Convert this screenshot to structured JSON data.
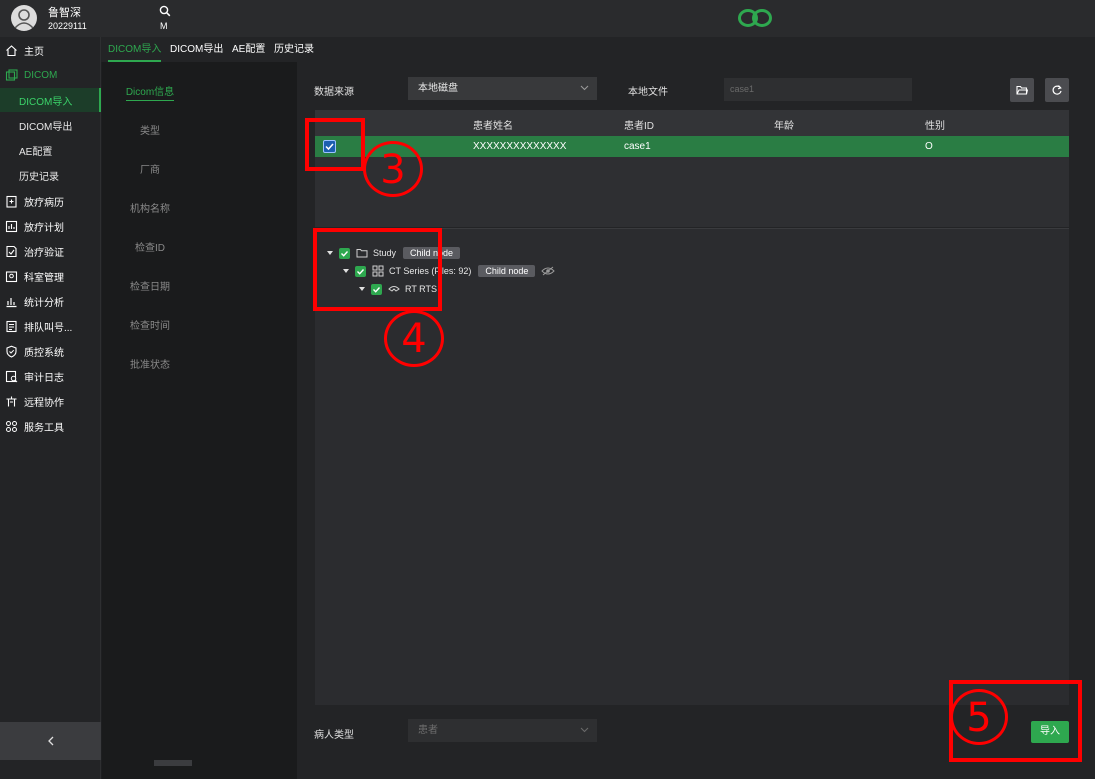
{
  "user": {
    "name": "鲁智深",
    "id": "20229111",
    "search_letter": "M"
  },
  "colors": {
    "accent": "#2ea84f",
    "annotation": "#ff0000",
    "row_selected": "#2a7d44"
  },
  "sidebar": {
    "items": [
      {
        "label": "主页",
        "icon": "home-icon"
      },
      {
        "label": "DICOM",
        "icon": "dicom-icon"
      },
      {
        "label": "放疗病历",
        "icon": "record-icon"
      },
      {
        "label": "放疗计划",
        "icon": "plan-icon"
      },
      {
        "label": "治疗验证",
        "icon": "verify-icon"
      },
      {
        "label": "科室管理",
        "icon": "department-icon"
      },
      {
        "label": "统计分析",
        "icon": "chart-icon"
      },
      {
        "label": "排队叫号...",
        "icon": "queue-icon"
      },
      {
        "label": "质控系统",
        "icon": "shield-icon"
      },
      {
        "label": "审计日志",
        "icon": "audit-icon"
      },
      {
        "label": "远程协作",
        "icon": "remote-icon"
      },
      {
        "label": "服务工具",
        "icon": "tools-icon"
      }
    ],
    "dicom_sub": [
      "DICOM导入",
      "DICOM导出",
      "AE配置",
      "历史记录"
    ]
  },
  "tabs": [
    "DICOM导入",
    "DICOM导出",
    "AE配置",
    "历史记录"
  ],
  "info_fields": [
    "Dicom信息",
    "类型",
    "厂商",
    "机构名称",
    "检查ID",
    "检查日期",
    "检查时间",
    "批准状态"
  ],
  "main": {
    "source_label": "数据来源",
    "source_value": "本地磁盘",
    "local_file_label": "本地文件",
    "local_file_value": "case1",
    "table": {
      "headers": [
        "患者姓名",
        "患者ID",
        "年龄",
        "性别"
      ],
      "rows": [
        {
          "name": "XXXXXXXXXXXXXX",
          "id": "case1",
          "age": "",
          "sex": "O"
        }
      ]
    },
    "tree": {
      "study": {
        "label": "Study",
        "tag": "Child node"
      },
      "series": {
        "label": "CT Series (Files: 92)",
        "tag": "Child node"
      },
      "rtstruct": {
        "label": "RT RTS"
      }
    },
    "patient_type_label": "病人类型",
    "patient_type_value": "患者",
    "import_label": "导入"
  },
  "annotations": [
    "3",
    "4",
    "5"
  ]
}
